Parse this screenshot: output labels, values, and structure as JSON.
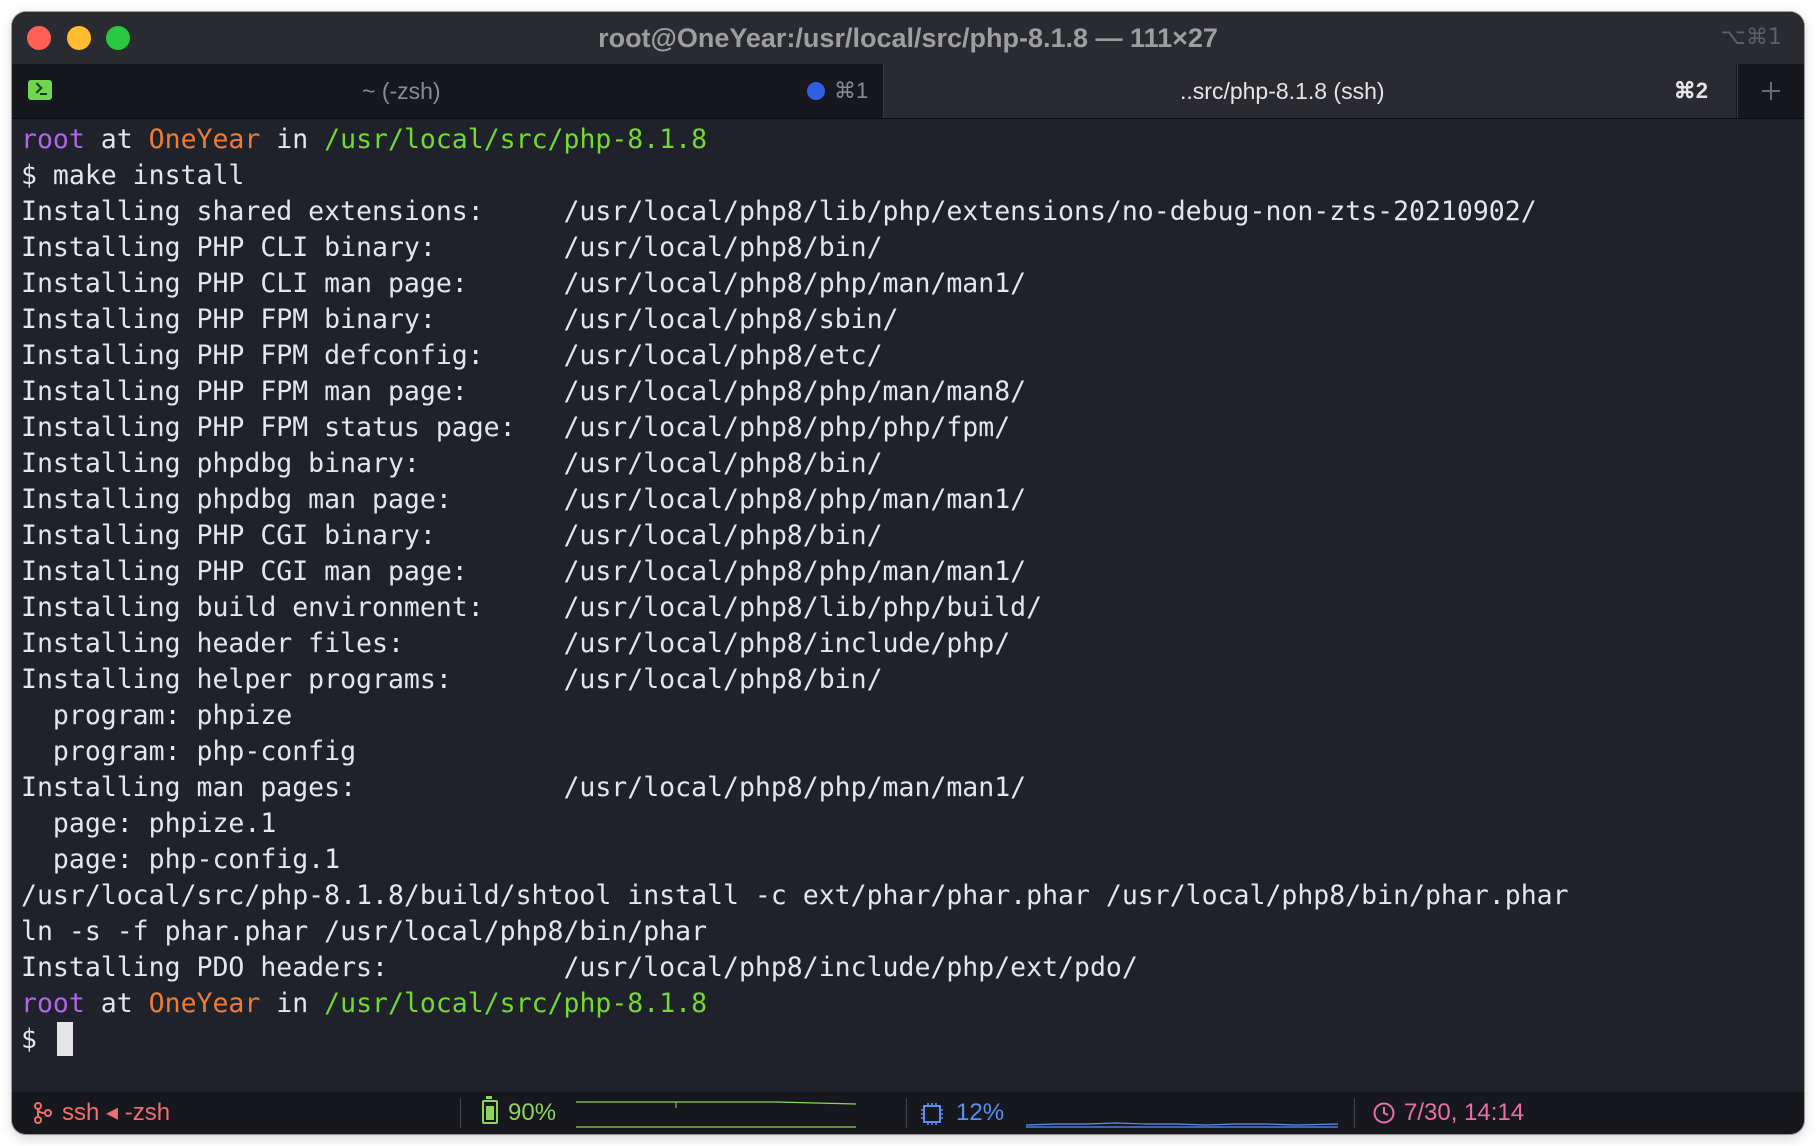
{
  "window": {
    "title": "root@OneYear:/usr/local/src/php-8.1.8 — 111×27",
    "title_shortcut": "⌥⌘1"
  },
  "tabs": [
    {
      "label": "~ (-zsh)",
      "shortcut": "⌘1",
      "active": false,
      "has_activity_dot": true,
      "dot_color": "#2d5fe0"
    },
    {
      "label": "..src/php-8.1.8 (ssh)",
      "shortcut": "⌘2",
      "active": true
    }
  ],
  "terminal": {
    "colors": {
      "user": "#b265e8",
      "host": "#f07b33",
      "path": "#73da2e",
      "text": "#e6e6ea",
      "background": "#20222b"
    },
    "prompt1": {
      "user": "root",
      "at": " at ",
      "host": "OneYear",
      "in": " in ",
      "path": "/usr/local/src/php-8.1.8"
    },
    "lines": [
      "$ make install",
      "Installing shared extensions:     /usr/local/php8/lib/php/extensions/no-debug-non-zts-20210902/",
      "Installing PHP CLI binary:        /usr/local/php8/bin/",
      "Installing PHP CLI man page:      /usr/local/php8/php/man/man1/",
      "Installing PHP FPM binary:        /usr/local/php8/sbin/",
      "Installing PHP FPM defconfig:     /usr/local/php8/etc/",
      "Installing PHP FPM man page:      /usr/local/php8/php/man/man8/",
      "Installing PHP FPM status page:   /usr/local/php8/php/php/fpm/",
      "Installing phpdbg binary:         /usr/local/php8/bin/",
      "Installing phpdbg man page:       /usr/local/php8/php/man/man1/",
      "Installing PHP CGI binary:        /usr/local/php8/bin/",
      "Installing PHP CGI man page:      /usr/local/php8/php/man/man1/",
      "Installing build environment:     /usr/local/php8/lib/php/build/",
      "Installing header files:          /usr/local/php8/include/php/",
      "Installing helper programs:       /usr/local/php8/bin/",
      "  program: phpize",
      "  program: php-config",
      "Installing man pages:             /usr/local/php8/php/man/man1/",
      "  page: phpize.1",
      "  page: php-config.1",
      "/usr/local/src/php-8.1.8/build/shtool install -c ext/phar/phar.phar /usr/local/php8/bin/phar.phar",
      "ln -s -f phar.phar /usr/local/php8/bin/phar",
      "Installing PDO headers:           /usr/local/php8/include/php/ext/pdo/",
      ""
    ],
    "prompt2": {
      "user": "root",
      "at": " at ",
      "host": "OneYear",
      "in": " in ",
      "path": "/usr/local/src/php-8.1.8"
    },
    "input_prompt": "$ "
  },
  "statusbar": {
    "process": "ssh ◂ -zsh",
    "process_icon": "branch-icon",
    "battery": "90%",
    "battery_icon": "battery-icon",
    "cpu": "12%",
    "cpu_icon": "cpu-icon",
    "clock": "7/30, 14:14",
    "clock_icon": "clock-icon",
    "colors": {
      "process": "#ef6f6f",
      "battery": "#8fd45a",
      "cpu": "#5b8ff0",
      "clock": "#e870a8"
    }
  }
}
